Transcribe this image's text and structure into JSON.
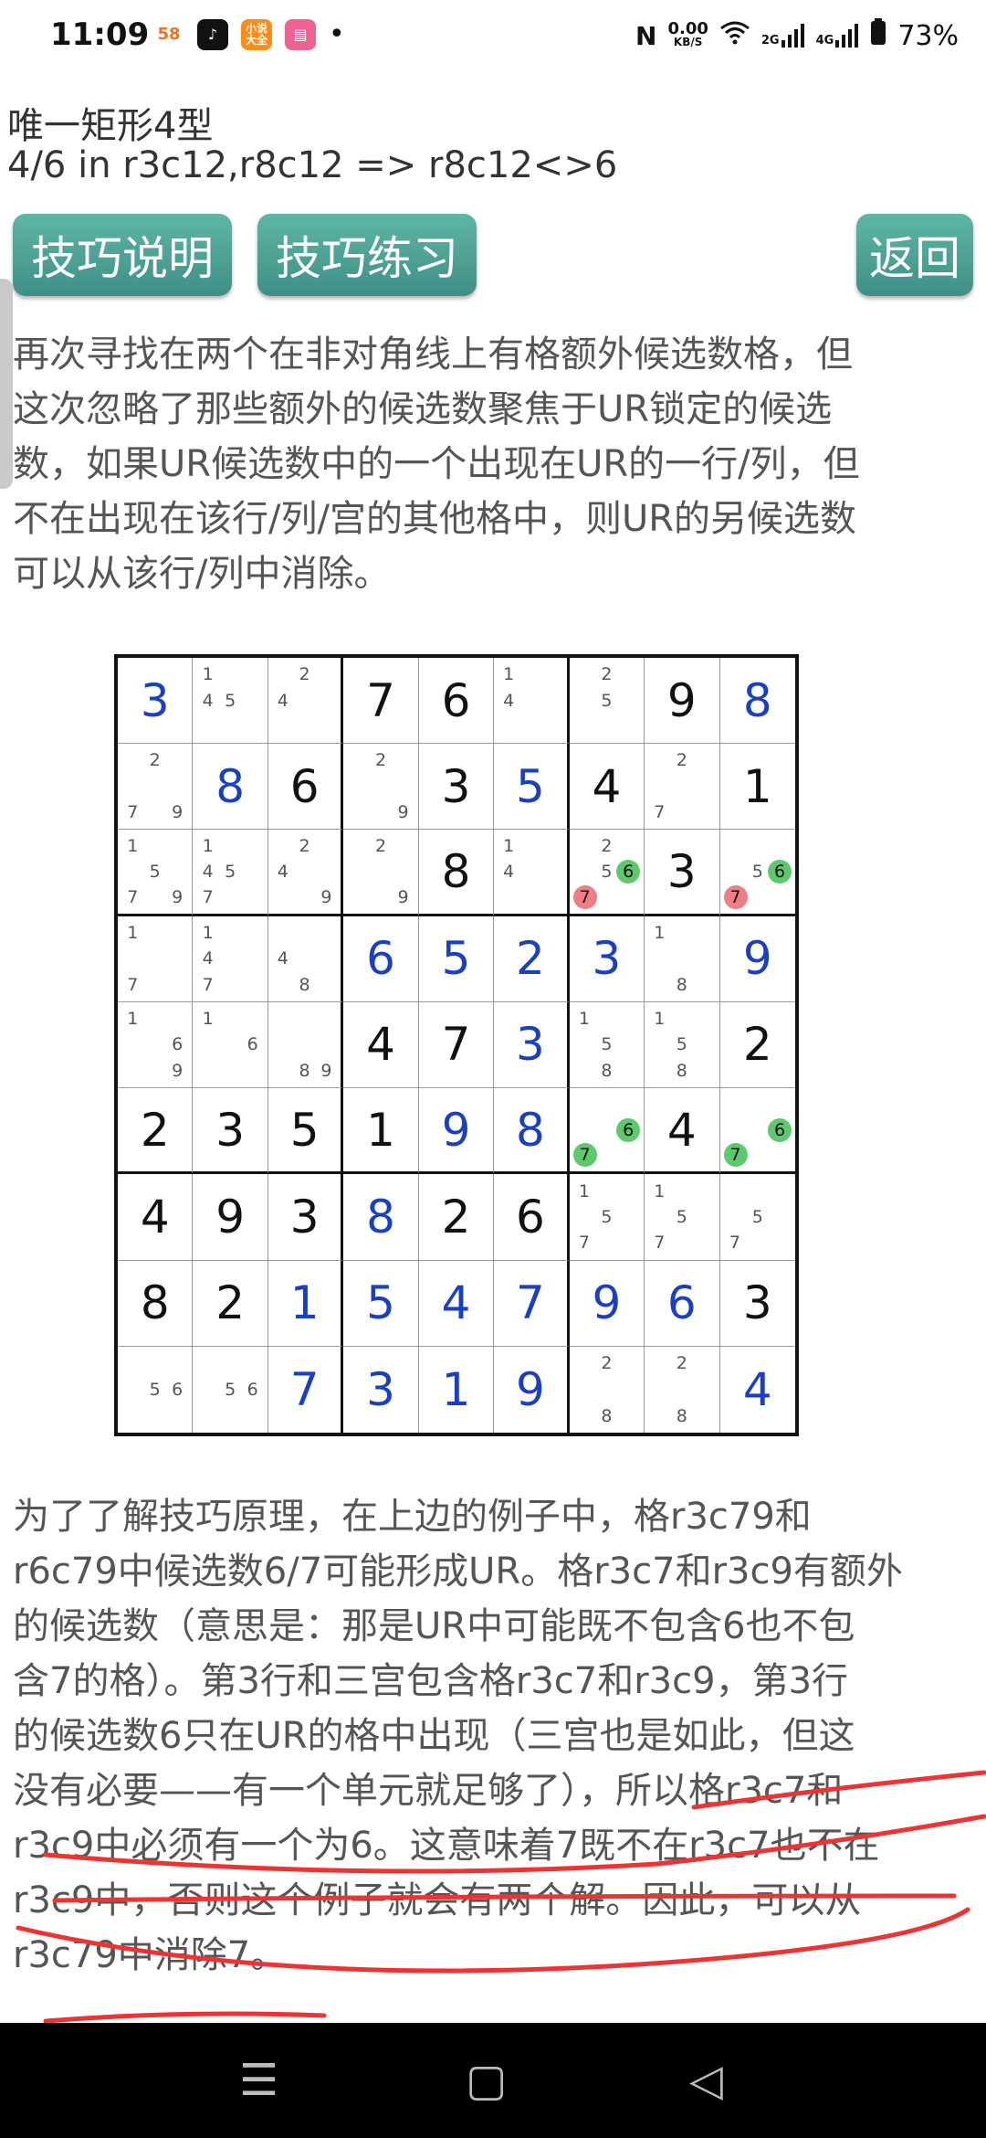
{
  "status": {
    "time": "11:09",
    "app_icons": [
      "58",
      "tiktok-icon",
      "小说大全",
      "app-icon"
    ],
    "dot": "•",
    "net_speed_top": "0.00",
    "net_speed_bottom": "KB/S",
    "signal1_label": "2G",
    "signal2_label": "4G",
    "battery": "73%"
  },
  "header": {
    "title": "唯一矩形4型",
    "subtitle": "4/6 in r3c12,r8c12 => r8c12<>6"
  },
  "buttons": {
    "explain": "技巧说明",
    "practice": "技巧练习",
    "back": "返回"
  },
  "desc_lines": [
    "再次寻找在两个在非对角线上有格额外候选数格，但",
    "这次忽略了那些额外的候选数聚焦于UR锁定的候选",
    "数，如果UR候选数中的一个出现在UR的一行/列，但",
    "不在出现在该行/列/宫的其他格中，则UR的另候选数",
    "可以从该行/列中消除。"
  ],
  "explain_lines": [
    "为了了解技巧原理，在上边的例子中，格r3c79和",
    "r6c79中候选数6/7可能形成UR。格r3c7和r3c9有额外",
    "的候选数（意思是：那是UR中可能既不包含6也不包",
    "含7的格）。第3行和三宫包含格r3c7和r3c9，第3行",
    "的候选数6只在UR的格中出现（三宫也是如此，但这",
    "没有必要——有一个单元就足够了），所以格r3c7和",
    "r3c9中必须有一个为6。这意味着7既不在r3c7也不在",
    "r3c9中，否则这个例子就会有两个解。因此，可以从",
    "r3c79中消除7。"
  ],
  "sudoku": [
    [
      {
        "v": "3",
        "s": 1
      },
      {
        "c": "1 45"
      },
      {
        "c": " 2 4"
      },
      {
        "v": "7"
      },
      {
        "v": "6"
      },
      {
        "c": "1 4"
      },
      {
        "c": " 2 5"
      },
      {
        "v": "9"
      },
      {
        "v": "8",
        "s": 1
      }
    ],
    [
      {
        "c": " 2 79"
      },
      {
        "v": "8",
        "s": 1
      },
      {
        "v": "6"
      },
      {
        "c": " 2 9"
      },
      {
        "v": "3"
      },
      {
        "v": "5",
        "s": 1
      },
      {
        "v": "4"
      },
      {
        "c": " 2 7"
      },
      {
        "v": "1"
      }
    ],
    [
      {
        "c": "1 5 79"
      },
      {
        "c": "1 45 7"
      },
      {
        "c": " 2 4 9"
      },
      {
        "c": " 2 9"
      },
      {
        "v": "8"
      },
      {
        "c": "1 4"
      },
      {
        "c": " 2 56 7",
        "g": "6",
        "r": "7"
      },
      {
        "v": "3"
      },
      {
        "c": "56 7",
        "g": "6",
        "r": "7"
      }
    ],
    [
      {
        "c": "1 7"
      },
      {
        "c": "1 4 7"
      },
      {
        "c": "4 8"
      },
      {
        "v": "6",
        "s": 1
      },
      {
        "v": "5",
        "s": 1
      },
      {
        "v": "2",
        "s": 1
      },
      {
        "v": "3",
        "s": 1
      },
      {
        "c": "1 8"
      },
      {
        "v": "9",
        "s": 1
      }
    ],
    [
      {
        "c": "1 6 9"
      },
      {
        "c": "1 6"
      },
      {
        "c": "89"
      },
      {
        "v": "4"
      },
      {
        "v": "7"
      },
      {
        "v": "3",
        "s": 1
      },
      {
        "c": "1 5 8"
      },
      {
        "c": "1 5 8"
      },
      {
        "v": "2"
      }
    ],
    [
      {
        "v": "2"
      },
      {
        "v": "3"
      },
      {
        "v": "5"
      },
      {
        "v": "1"
      },
      {
        "v": "9",
        "s": 1
      },
      {
        "v": "8",
        "s": 1
      },
      {
        "c": "67",
        "g": "6",
        "g2": "7"
      },
      {
        "v": "4"
      },
      {
        "c": "67",
        "g": "6",
        "g2": "7"
      }
    ],
    [
      {
        "v": "4"
      },
      {
        "v": "9"
      },
      {
        "v": "3"
      },
      {
        "v": "8",
        "s": 1
      },
      {
        "v": "2"
      },
      {
        "v": "6"
      },
      {
        "c": "1 5 7"
      },
      {
        "c": "1 5 7"
      },
      {
        "c": "5 7"
      }
    ],
    [
      {
        "v": "8"
      },
      {
        "v": "2"
      },
      {
        "v": "1",
        "s": 1
      },
      {
        "v": "5",
        "s": 1
      },
      {
        "v": "4",
        "s": 1
      },
      {
        "v": "7",
        "s": 1
      },
      {
        "v": "9",
        "s": 1
      },
      {
        "v": "6",
        "s": 1
      },
      {
        "v": "3"
      }
    ],
    [
      {
        "c": "56"
      },
      {
        "c": "56"
      },
      {
        "v": "7",
        "s": 1
      },
      {
        "v": "3",
        "s": 1
      },
      {
        "v": "1",
        "s": 1
      },
      {
        "v": "9",
        "s": 1
      },
      {
        "c": " 2 8"
      },
      {
        "c": " 2 8"
      },
      {
        "v": "4",
        "s": 1
      }
    ]
  ],
  "sudoku_candidates": [
    [
      [],
      [
        "1",
        "4",
        "5"
      ],
      [
        "2",
        "4"
      ],
      [],
      [],
      [
        "1",
        "4"
      ],
      [
        "2",
        "5"
      ],
      [],
      []
    ],
    [
      [
        "2",
        "7",
        "9"
      ],
      [],
      [],
      [
        "2",
        "9"
      ],
      [],
      [],
      [],
      [
        "2",
        "7"
      ],
      []
    ],
    [
      [
        "1",
        "5",
        "7",
        "9"
      ],
      [
        "1",
        "4",
        "5",
        "7"
      ],
      [
        "2",
        "4",
        "9"
      ],
      [
        "2",
        "9"
      ],
      [],
      [
        "1",
        "4"
      ],
      [
        "2",
        "5",
        "6",
        "7"
      ],
      [],
      [
        "5",
        "6",
        "7"
      ]
    ],
    [
      [
        "1",
        "7"
      ],
      [
        "1",
        "4",
        "7"
      ],
      [
        "4",
        "8"
      ],
      [],
      [],
      [],
      [],
      [
        "1",
        "8"
      ],
      []
    ],
    [
      [
        "1",
        "6",
        "9"
      ],
      [
        "1",
        "6"
      ],
      [
        "8",
        "9"
      ],
      [],
      [],
      [],
      [
        "1",
        "5",
        "8"
      ],
      [
        "1",
        "5",
        "8"
      ],
      []
    ],
    [
      [],
      [],
      [],
      [],
      [],
      [],
      [
        "6",
        "7"
      ],
      [],
      [
        "6",
        "7"
      ]
    ],
    [
      [],
      [],
      [],
      [],
      [],
      [],
      [
        "1",
        "5",
        "7"
      ],
      [
        "1",
        "5",
        "7"
      ],
      [
        "5",
        "7"
      ]
    ],
    [
      [],
      [],
      [],
      [],
      [],
      [],
      [],
      [],
      []
    ],
    [
      [
        "5",
        "6"
      ],
      [
        "5",
        "6"
      ],
      [],
      [],
      [],
      [],
      [
        "2",
        "8"
      ],
      [
        "2",
        "8"
      ],
      []
    ]
  ],
  "nav": {
    "menu": "☰",
    "home": "▢",
    "back": "◁"
  }
}
